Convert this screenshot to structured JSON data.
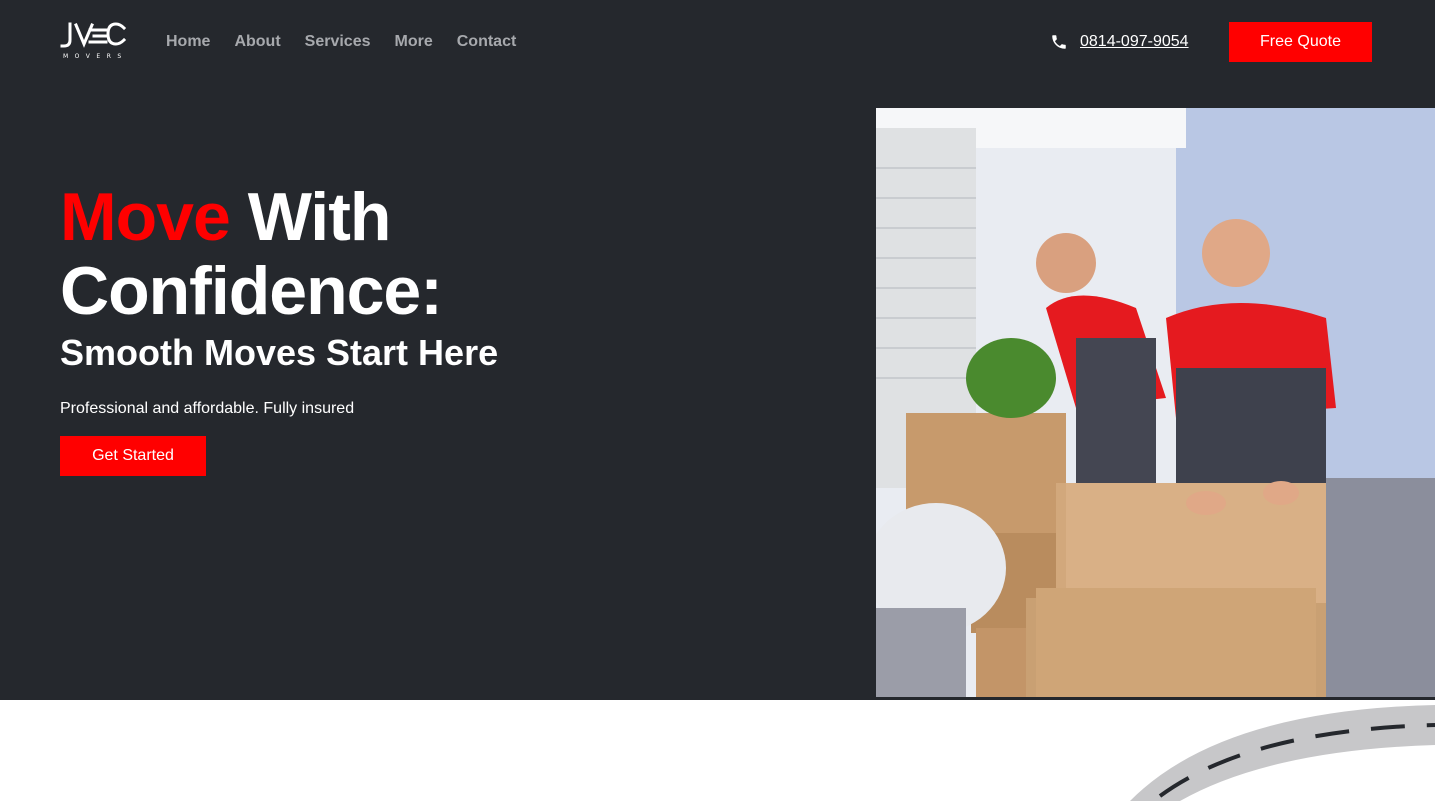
{
  "brand": {
    "logo_text": "JVEC",
    "logo_subtext": "MOVERS"
  },
  "nav": {
    "items": [
      "Home",
      "About",
      "Services",
      "More",
      "Contact"
    ]
  },
  "header": {
    "phone": "0814-097-9054",
    "phone_icon": "phone-icon",
    "quote_label": "Free Quote"
  },
  "hero": {
    "headline_accent": "Move",
    "headline_rest_line1": " With",
    "headline_line2": "Confidence:",
    "subheadline": "Smooth Moves Start Here",
    "tagline": "Professional and affordable. Fully insured",
    "cta_label": "Get Started"
  },
  "colors": {
    "dark_bg": "#25282d",
    "accent": "#ff0000",
    "nav_text": "#a7a9ad"
  }
}
